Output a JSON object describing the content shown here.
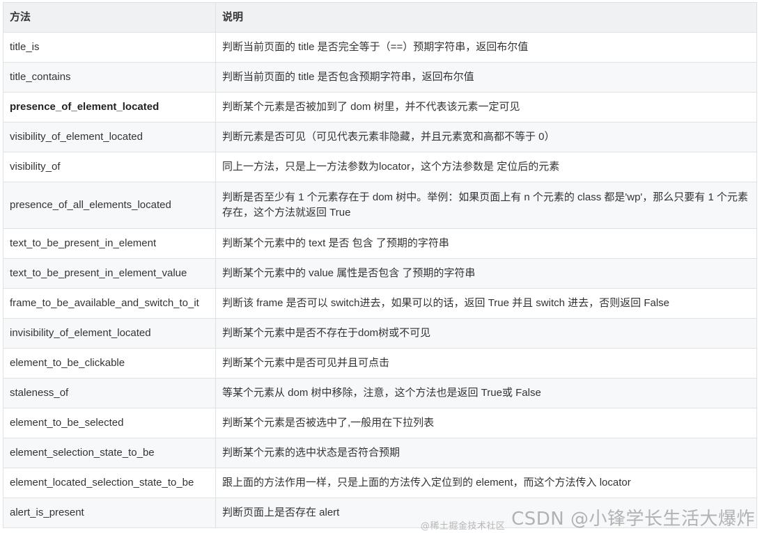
{
  "header": {
    "col_method": "方法",
    "col_description": "说明"
  },
  "rows": [
    {
      "method": "title_is",
      "description": "判断当前页面的 title 是否完全等于（==）预期字符串，返回布尔值"
    },
    {
      "method": "title_contains",
      "description": "判断当前页面的 title 是否包含预期字符串，返回布尔值"
    },
    {
      "method": "presence_of_element_located",
      "description": "判断某个元素是否被加到了 dom 树里，并不代表该元素一定可见"
    },
    {
      "method": "visibility_of_element_located",
      "description": "判断元素是否可见（可见代表元素非隐藏，并且元素宽和高都不等于 0）"
    },
    {
      "method": "visibility_of",
      "description": "同上一方法，只是上一方法参数为locator，这个方法参数是 定位后的元素"
    },
    {
      "method": "presence_of_all_elements_located",
      "description": "判断是否至少有 1 个元素存在于 dom 树中。举例：如果页面上有 n 个元素的 class 都是'wp'，那么只要有 1 个元素存在，这个方法就返回 True"
    },
    {
      "method": "text_to_be_present_in_element",
      "description": "判断某个元素中的 text 是否 包含 了预期的字符串"
    },
    {
      "method": "text_to_be_present_in_element_value",
      "description": "判断某个元素中的 value 属性是否包含 了预期的字符串"
    },
    {
      "method": "frame_to_be_available_and_switch_to_it",
      "description": "判断该 frame 是否可以 switch进去，如果可以的话，返回 True 并且 switch 进去，否则返回 False"
    },
    {
      "method": "invisibility_of_element_located",
      "description": "判断某个元素中是否不存在于dom树或不可见"
    },
    {
      "method": "element_to_be_clickable",
      "description": "判断某个元素中是否可见并且可点击"
    },
    {
      "method": "staleness_of",
      "description": "等某个元素从 dom 树中移除，注意，这个方法也是返回 True或 False"
    },
    {
      "method": "element_to_be_selected",
      "description": "判断某个元素是否被选中了,一般用在下拉列表"
    },
    {
      "method": "element_selection_state_to_be",
      "description": "判断某个元素的选中状态是否符合预期"
    },
    {
      "method": "element_located_selection_state_to_be",
      "description": "跟上面的方法作用一样，只是上面的方法传入定位到的 element，而这个方法传入 locator"
    },
    {
      "method": "alert_is_present",
      "description": "判断页面上是否存在 alert"
    }
  ],
  "watermark": {
    "main": "CSDN @小锋学长生活大爆炸",
    "sub": "@稀土掘金技术社区"
  }
}
